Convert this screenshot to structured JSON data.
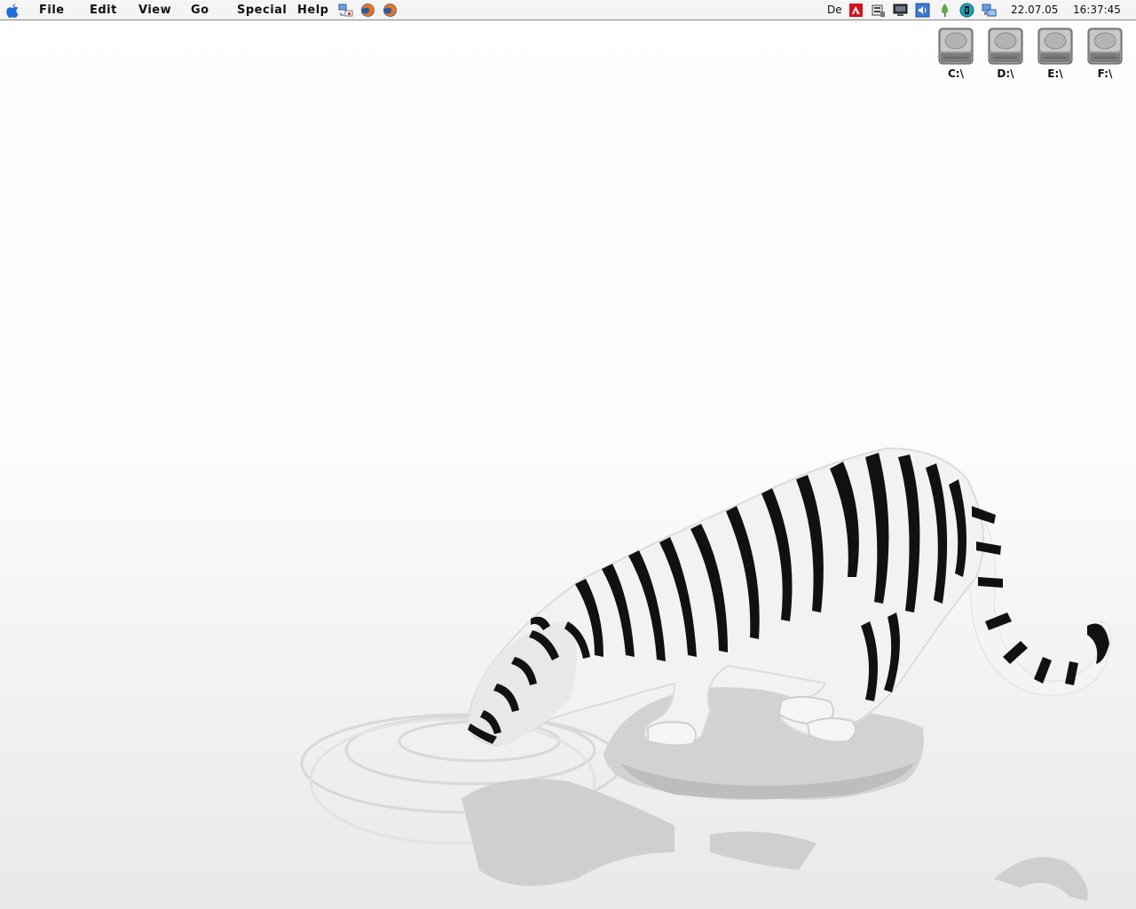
{
  "menubar": {
    "items": [
      "File",
      "Edit",
      "View",
      "Go",
      "Special",
      "Help"
    ],
    "quicklaunch": [
      "network-swap-icon",
      "firefox-icon",
      "firefox-icon"
    ],
    "tray": {
      "lang": "De",
      "icons": [
        "antivir-icon",
        "scanner-icon",
        "monitor-icon",
        "volume-icon",
        "pin-icon",
        "update-icon",
        "network-icon"
      ]
    },
    "date": "22.07.05",
    "time": "16:37:45"
  },
  "desktop": {
    "drives": [
      {
        "label": "C:\\",
        "icon": "hard-drive-icon"
      },
      {
        "label": "D:\\",
        "icon": "hard-drive-icon"
      },
      {
        "label": "E:\\",
        "icon": "hard-drive-icon"
      },
      {
        "label": "F:\\",
        "icon": "hard-drive-icon"
      }
    ],
    "wallpaper": "white-tiger-wallpaper"
  },
  "colors": {
    "accent": "#1f6fd6",
    "menubar": "#f0f0f0",
    "text": "#111111"
  }
}
